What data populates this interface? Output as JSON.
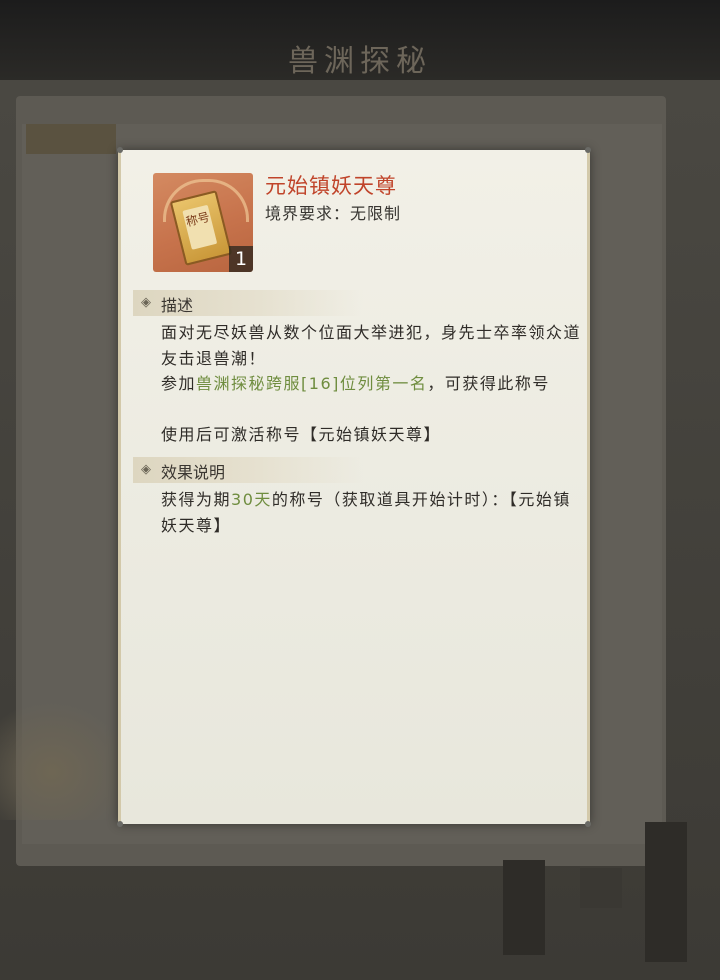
{
  "background": {
    "screen_title": "兽渊探秘"
  },
  "item": {
    "icon": "title-scroll-icon",
    "icon_label": "称号",
    "count": "1",
    "name": "元始镇妖天尊",
    "realm_requirement": "境界要求：无限制"
  },
  "description": {
    "header": "描述",
    "line1": "面对无尽妖兽从数个位面大举进犯，身先士卒率领众道友击退兽潮！",
    "line2_prefix": "参加",
    "line2_highlight": "兽渊探秘跨服[16]位列第一名",
    "line2_suffix": "，可获得此称号",
    "line3": "使用后可激活称号【元始镇妖天尊】"
  },
  "effect": {
    "header": "效果说明",
    "text_prefix": "获得为期",
    "text_highlight": "30天",
    "text_suffix": "的称号（获取道具开始计时）：【元始镇妖天尊】"
  },
  "colors": {
    "item_name": "#c0442a",
    "highlight": "#6f8d3f",
    "panel_bg": "#f2f0e7"
  }
}
